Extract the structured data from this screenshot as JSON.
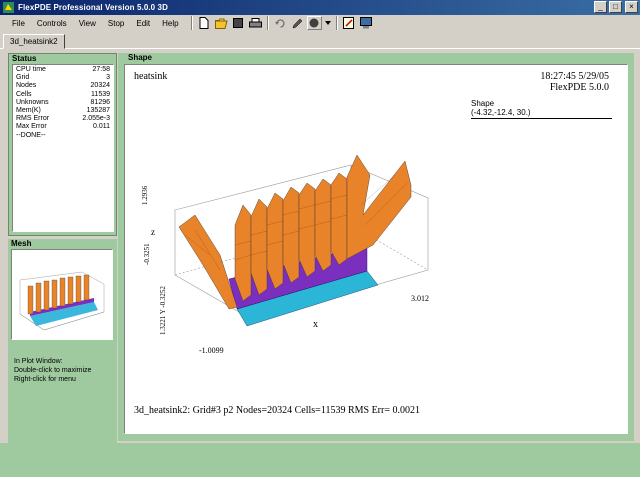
{
  "window": {
    "title": "FlexPDE Professional Version 5.0.0 3D",
    "minimize": "_",
    "maximize": "□",
    "close": "×"
  },
  "menu": {
    "items": [
      "File",
      "Controls",
      "View",
      "Stop",
      "Edit",
      "Help"
    ]
  },
  "toolbar": {
    "icons": [
      "new-file-icon",
      "open-folder-icon",
      "stop-square-icon",
      "print-icon",
      "rotate-icon",
      "pencil-icon",
      "circle-icon",
      "dropdown-icon",
      "edit-document-icon",
      "monitor-icon"
    ]
  },
  "tabs": {
    "active": "3d_heatsink2"
  },
  "status": {
    "header": "Status",
    "rows": [
      {
        "label": "CPU time",
        "value": "27:58"
      },
      {
        "label": "Grid",
        "value": "3"
      },
      {
        "label": "Nodes",
        "value": "20324"
      },
      {
        "label": "Cells",
        "value": "11539"
      },
      {
        "label": "Unknowns",
        "value": "81296"
      },
      {
        "label": "Mem(K)",
        "value": "135287"
      },
      {
        "label": "RMS Error",
        "value": "2.055e-3"
      },
      {
        "label": "Max Error",
        "value": "0.011"
      }
    ],
    "done": "--DONE--"
  },
  "mesh": {
    "header": "Mesh",
    "hint_lines": [
      "In Plot Window:",
      "Double-click to maximize",
      "Right-click for menu"
    ]
  },
  "shape": {
    "header": "Shape",
    "plot_title": "heatsink",
    "time_line1": "18:27:45 5/29/05",
    "time_line2": "FlexPDE 5.0.0",
    "legend_title": "Shape",
    "legend_value": "(-4.32,-12.4, 30.)",
    "axis_z": "z",
    "z_max": "1.2936",
    "z_min": "-0.3251",
    "y_range": "1.3221 Y -0.3252",
    "x_label": "x",
    "x_max": "3.012",
    "x_min": "-1.0099",
    "footer": "3d_heatsink2:  Grid#3  p2  Nodes=20324 Cells=11539 RMS Err= 0.0021"
  },
  "colors": {
    "panel_green": "#9fc99f",
    "title_blue": "#0a246a",
    "fin_orange": "#e8832a",
    "base_purple": "#7b2fbe",
    "base_cyan": "#2bb6d8"
  }
}
